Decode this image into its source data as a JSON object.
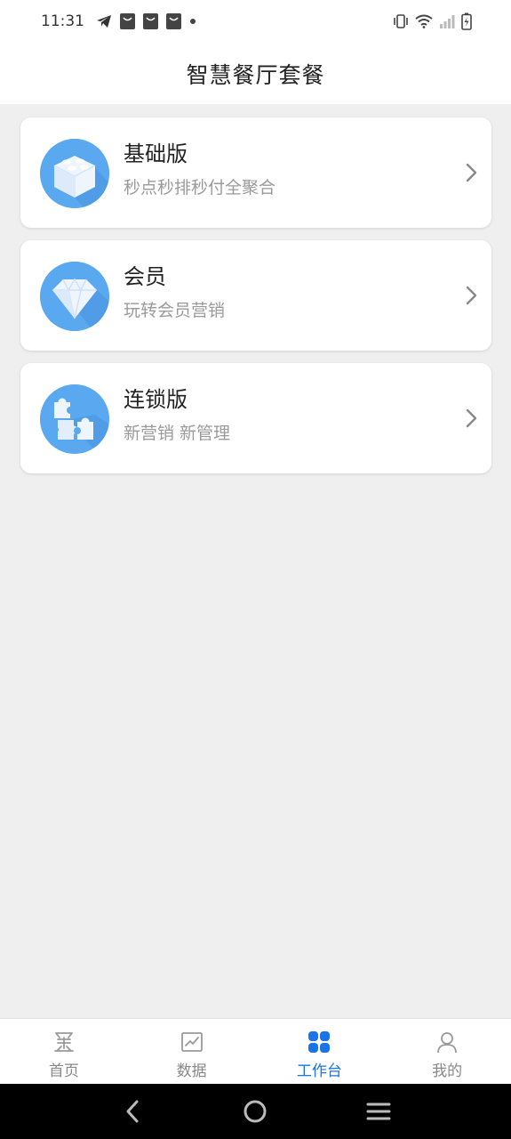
{
  "status_bar": {
    "time": "11:31",
    "left_icons": [
      "telegram-icon",
      "shopping-bag-icon",
      "shopping-bag-icon",
      "shopping-bag-icon",
      "dot-icon"
    ],
    "right_icons": [
      "vibrate-icon",
      "wifi-icon",
      "signal-icon",
      "battery-charging-icon"
    ]
  },
  "header": {
    "title": "智慧餐厅套餐"
  },
  "packages": [
    {
      "title": "基础版",
      "subtitle": "秒点秒排秒付全聚合",
      "icon": "lego-block-icon"
    },
    {
      "title": "会员",
      "subtitle": "玩转会员营销",
      "icon": "diamond-icon"
    },
    {
      "title": "连锁版",
      "subtitle": "新营销 新管理",
      "icon": "puzzle-icon"
    }
  ],
  "tabbar": {
    "tabs": [
      {
        "label": "首页",
        "icon": "home-logo-icon",
        "active": false
      },
      {
        "label": "数据",
        "icon": "chart-icon",
        "active": false
      },
      {
        "label": "工作台",
        "icon": "workbench-grid-icon",
        "active": true
      },
      {
        "label": "我的",
        "icon": "user-icon",
        "active": false
      }
    ]
  },
  "colors": {
    "accent": "#1a73e8",
    "card_icon_bg": "#5aa9f0",
    "page_bg": "#efefef",
    "tab_inactive": "#888888"
  }
}
